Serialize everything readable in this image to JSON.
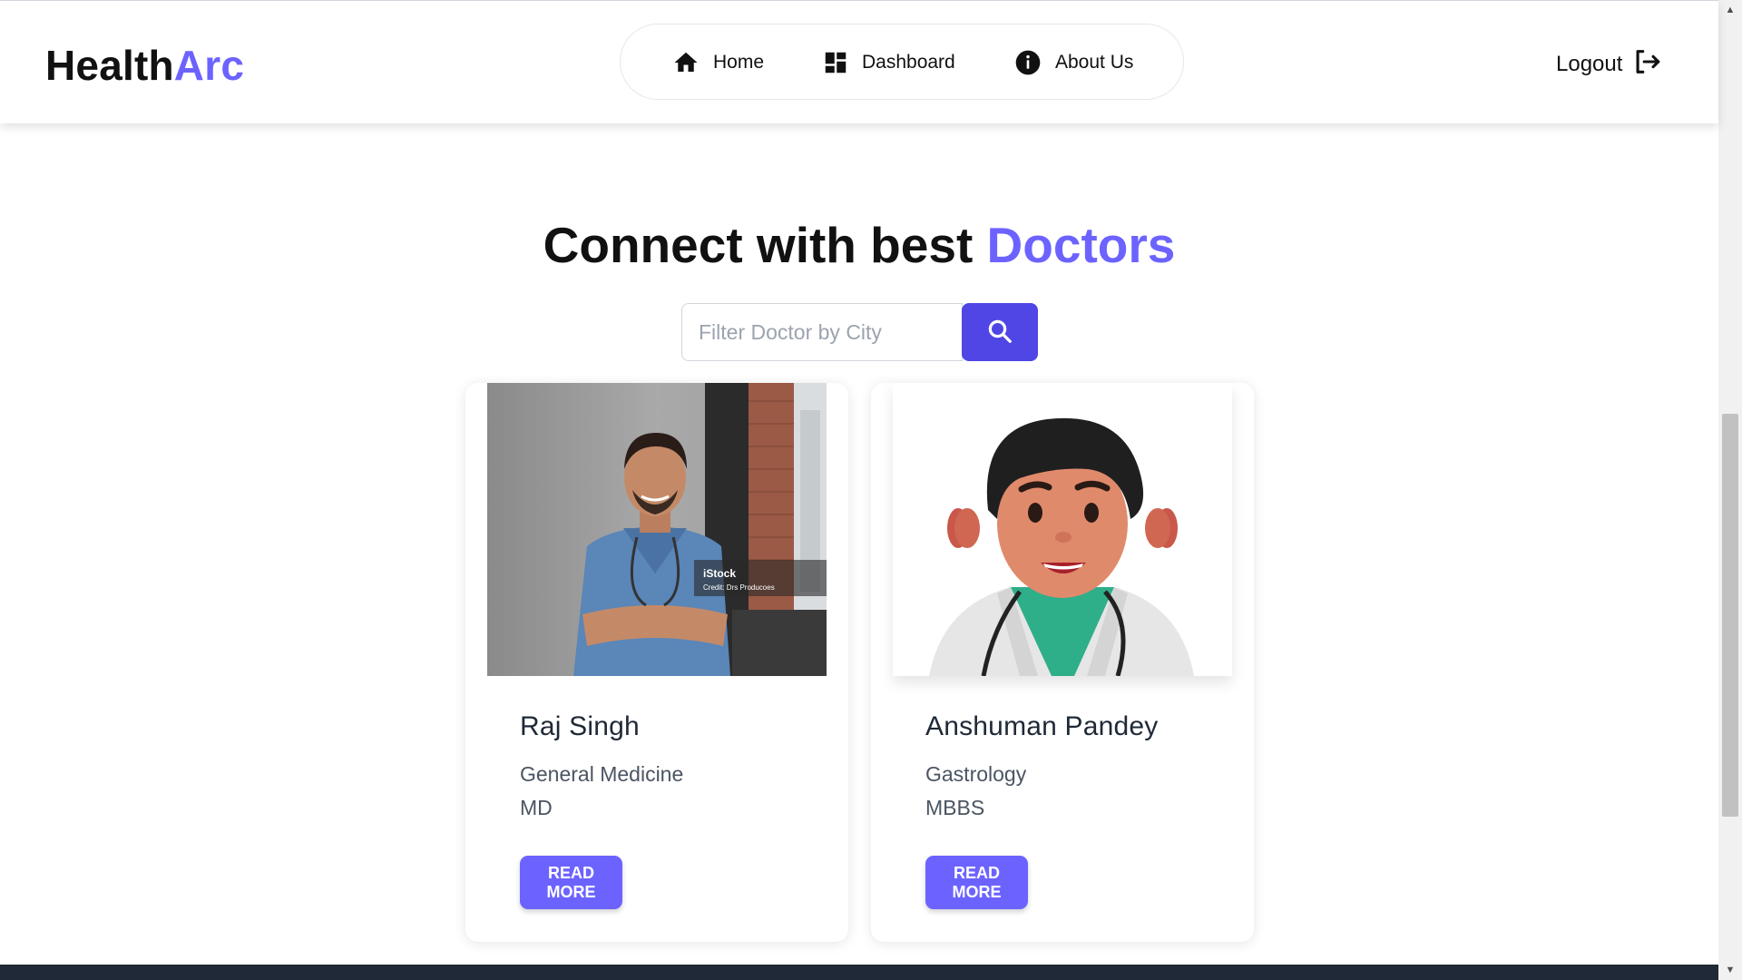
{
  "brand": {
    "part1": "Health",
    "part2": "Arc",
    "accent_color": "#6c63ff"
  },
  "nav": {
    "items": [
      {
        "label": "Home",
        "icon": "home-icon"
      },
      {
        "label": "Dashboard",
        "icon": "dashboard-icon"
      },
      {
        "label": "About Us",
        "icon": "info-icon"
      }
    ],
    "logout_label": "Logout",
    "logout_icon": "logout-icon"
  },
  "hero": {
    "heading_part1": "Connect with best",
    "heading_part2": "Doctors"
  },
  "search": {
    "placeholder": "Filter Doctor by City",
    "value": "",
    "button_icon": "search-icon",
    "button_color": "#4f46e5"
  },
  "doctors": [
    {
      "name": "Raj Singh",
      "specialization": "General Medicine",
      "degree": "MD",
      "read_more_label": "READ MORE",
      "photo_watermark": "iStock",
      "photo_credit": "Credit: Drs Producoes"
    },
    {
      "name": "Anshuman Pandey",
      "specialization": "Gastrology",
      "degree": "MBBS",
      "read_more_label": "READ MORE"
    }
  ],
  "colors": {
    "primary": "#6c63ff",
    "footer": "#1f2937"
  }
}
